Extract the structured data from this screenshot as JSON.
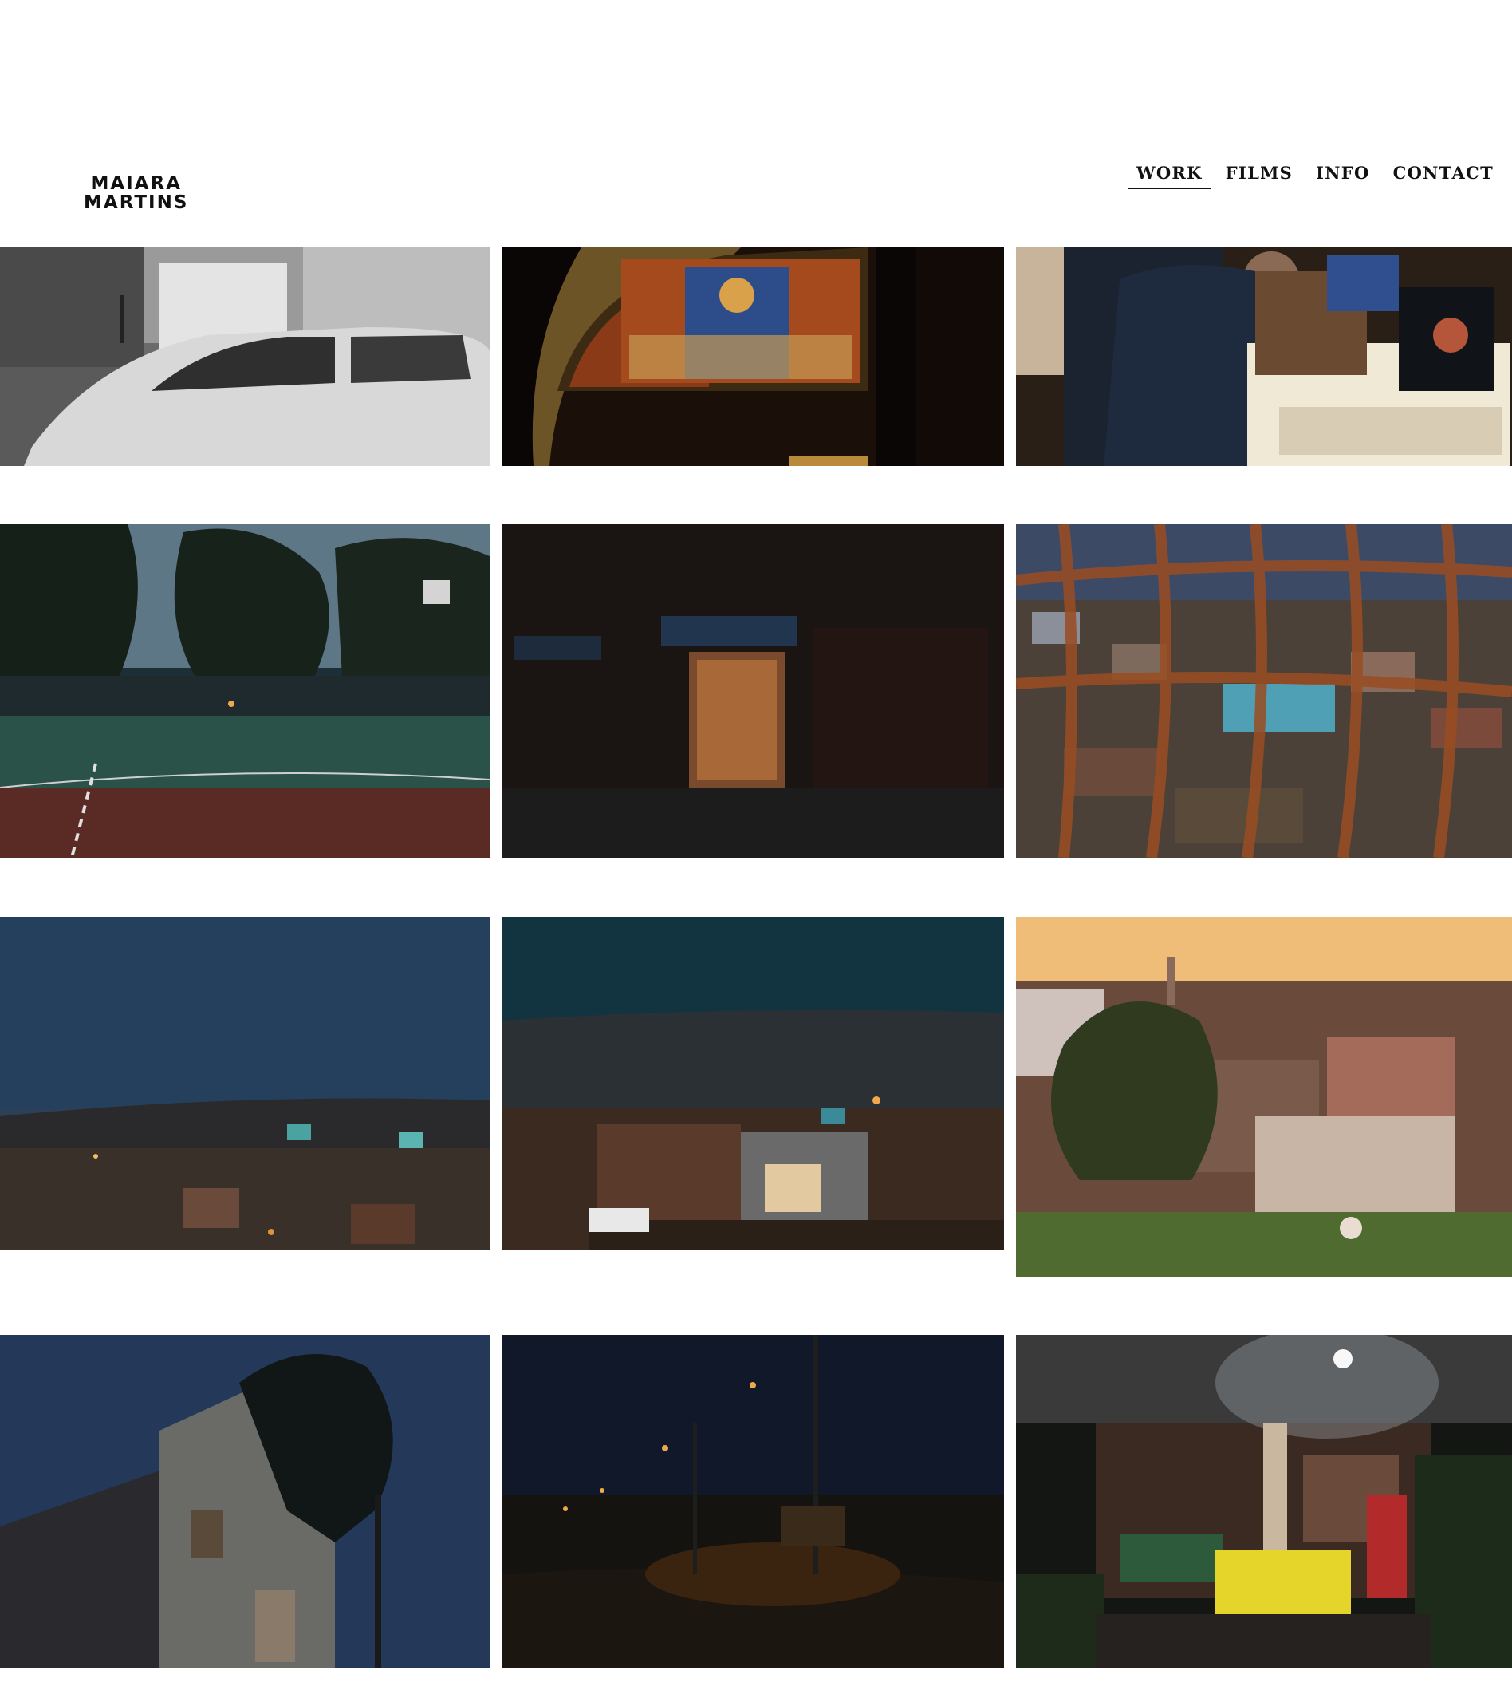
{
  "site": {
    "logo_line1": "MAIARA",
    "logo_line2": "MARTINS"
  },
  "nav": {
    "items": [
      "WORK",
      "FILMS",
      "INFO",
      "CONTACT"
    ],
    "active": "WORK"
  },
  "gallery": {
    "items": [
      {
        "subject": "black and white street scene with passing car"
      },
      {
        "subject": "stained glass window in dark church"
      },
      {
        "subject": "man arranging religious figurines under light"
      },
      {
        "subject": "basketball court at dusk with trees"
      },
      {
        "subject": "lit doorway in dark brick building"
      },
      {
        "subject": "hillside houses seen through fence at dusk"
      },
      {
        "subject": "city hillside under blue evening sky"
      },
      {
        "subject": "neighborhood at night with white car"
      },
      {
        "subject": "sunset over hillside town, couple on grass"
      },
      {
        "subject": "old church facade and tree at dusk"
      },
      {
        "subject": "dark road with street lamps at night"
      },
      {
        "subject": "covered patio with yellow chairs at night"
      }
    ]
  }
}
